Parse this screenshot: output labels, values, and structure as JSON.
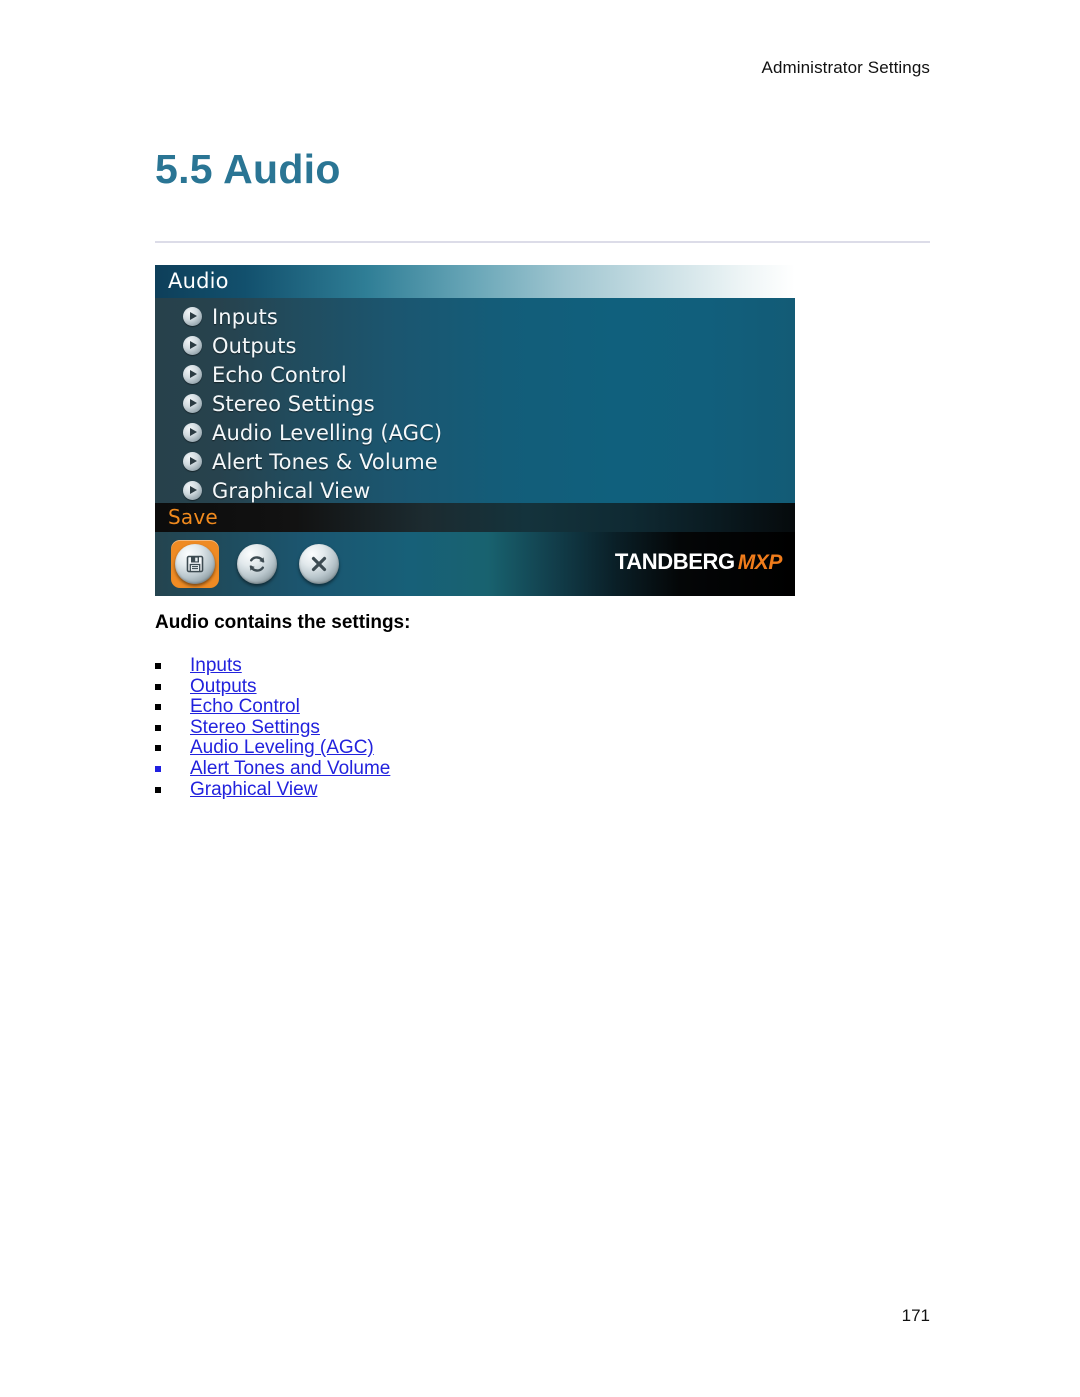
{
  "document": {
    "running_header": "Administrator Settings",
    "section_number_title": "5.5 Audio",
    "page_number": "171"
  },
  "device_screenshot": {
    "title": "Audio",
    "menu_items": [
      {
        "label": "Inputs",
        "icon": "arrow-right-icon"
      },
      {
        "label": "Outputs",
        "icon": "arrow-right-icon"
      },
      {
        "label": "Echo Control",
        "icon": "arrow-right-icon"
      },
      {
        "label": "Stereo Settings",
        "icon": "arrow-right-icon"
      },
      {
        "label": "Audio Levelling (AGC)",
        "icon": "arrow-right-icon"
      },
      {
        "label": "Alert Tones & Volume",
        "icon": "arrow-right-icon"
      },
      {
        "label": "Graphical View",
        "icon": "arrow-right-icon"
      }
    ],
    "softkey_label": "Save",
    "toolbar_icons": [
      {
        "name": "save-floppy-icon",
        "selected": true
      },
      {
        "name": "refresh-icon",
        "selected": false
      },
      {
        "name": "close-x-icon",
        "selected": false
      }
    ],
    "brand": {
      "main": "TANDBERG",
      "sub": "MXP"
    },
    "colors": {
      "titlebar_dark": "#0e3f5a",
      "titlebar_light": "#ffffff",
      "body_teal": "#125d78",
      "softkey_text": "#f08a1e",
      "selection_highlight": "#ef8b24",
      "brand_accent": "#f07c1b"
    }
  },
  "content": {
    "contains_title": "Audio contains the settings:",
    "settings_links": [
      {
        "label": "Inputs",
        "bullet_color": "black"
      },
      {
        "label": "Outputs",
        "bullet_color": "black"
      },
      {
        "label": "Echo Control",
        "bullet_color": "black"
      },
      {
        "label": "Stereo Settings",
        "bullet_color": "black"
      },
      {
        "label": "Audio Leveling (AGC)",
        "bullet_color": "black"
      },
      {
        "label": "Alert Tones and Volume",
        "bullet_color": "blue"
      },
      {
        "label": "Graphical View",
        "bullet_color": "black"
      }
    ],
    "link_color": "#2222dd",
    "heading_color": "#2a7594"
  }
}
